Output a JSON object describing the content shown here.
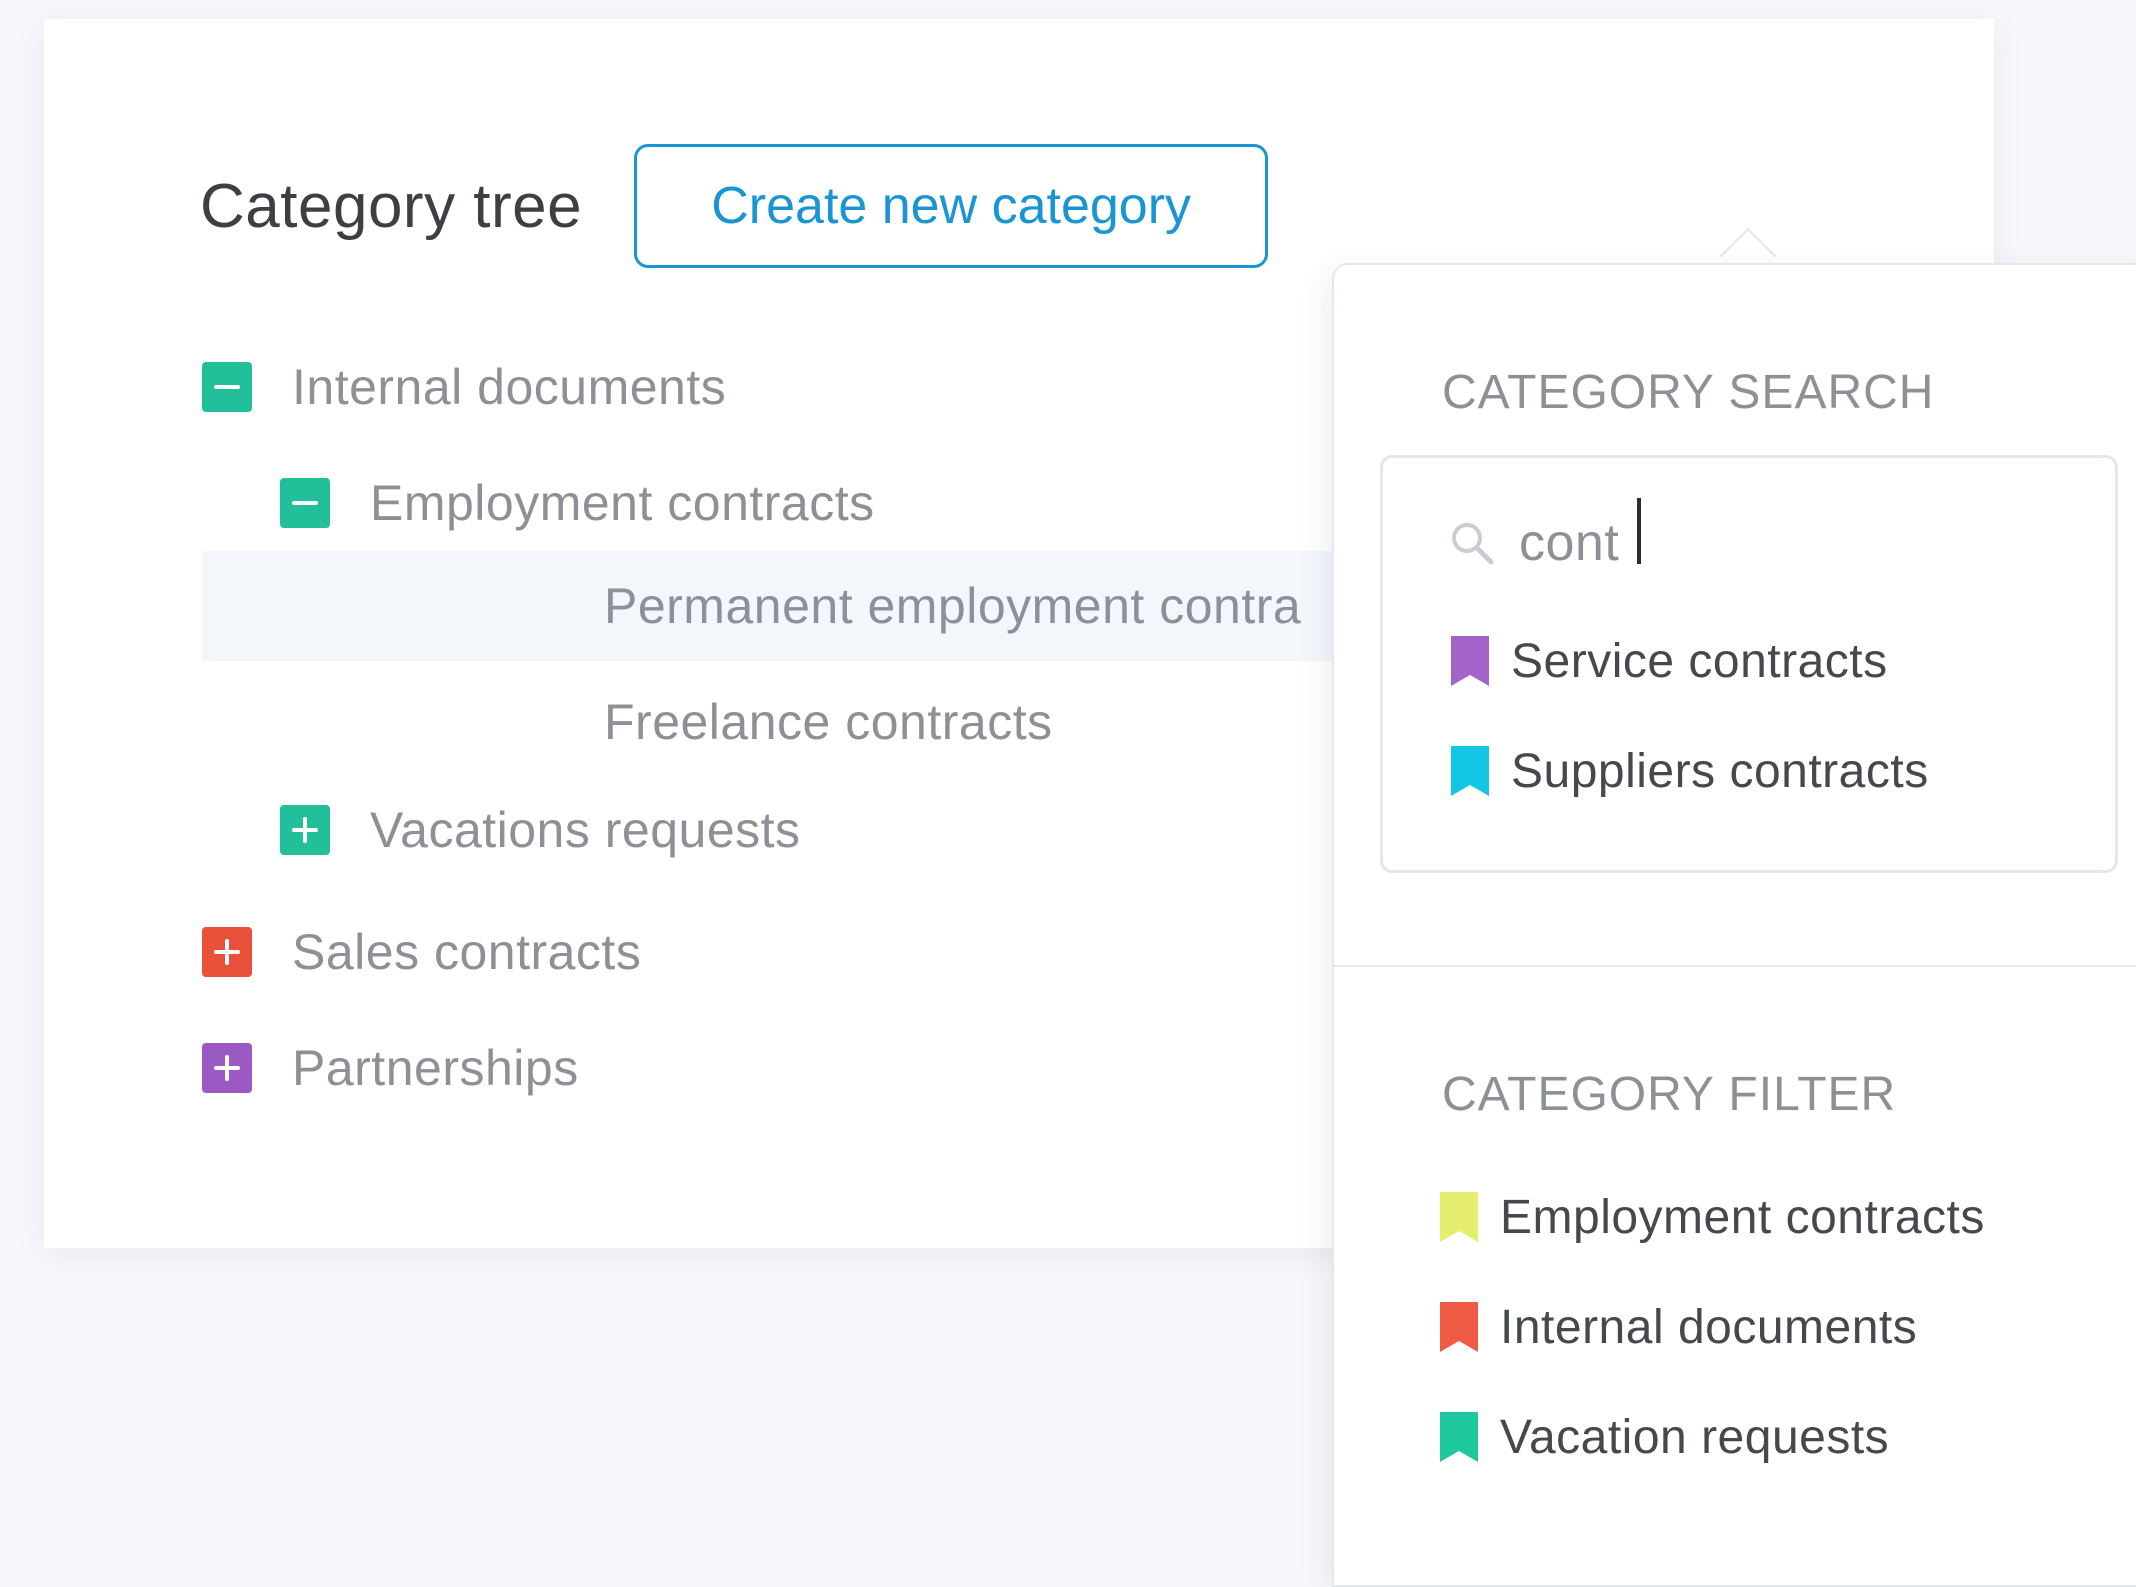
{
  "tree": {
    "title": "Category tree",
    "create_button": "Create new category",
    "items": [
      {
        "label": "Internal documents",
        "toggle": "collapse",
        "color": "#21c09a"
      },
      {
        "label": "Employment contracts",
        "toggle": "collapse",
        "color": "#21c09a"
      },
      {
        "label": "Permanent employment contra",
        "selected": true
      },
      {
        "label": "Freelance contracts"
      },
      {
        "label": "Vacations requests",
        "toggle": "expand",
        "color": "#21c09a"
      },
      {
        "label": "Sales contracts",
        "toggle": "expand",
        "color": "#e8503a"
      },
      {
        "label": "Partnerships",
        "toggle": "expand",
        "color": "#9b59c4"
      }
    ]
  },
  "search": {
    "title": "CATEGORY SEARCH",
    "query": "cont",
    "icon": "search-icon",
    "results": [
      {
        "label": "Service contracts",
        "color": "#a463c8"
      },
      {
        "label": "Suppliers contracts",
        "color": "#14c6e6"
      }
    ]
  },
  "filter": {
    "title": "CATEGORY FILTER",
    "items": [
      {
        "label": "Employment contracts",
        "color": "#e6ee6f"
      },
      {
        "label": "Internal documents",
        "color": "#ef5a45"
      },
      {
        "label": "Vacation requests",
        "color": "#1fc79f"
      }
    ]
  },
  "colors": {
    "accent": "#1a95d4",
    "text_muted": "#8d9096",
    "text_dark": "#45484d"
  }
}
